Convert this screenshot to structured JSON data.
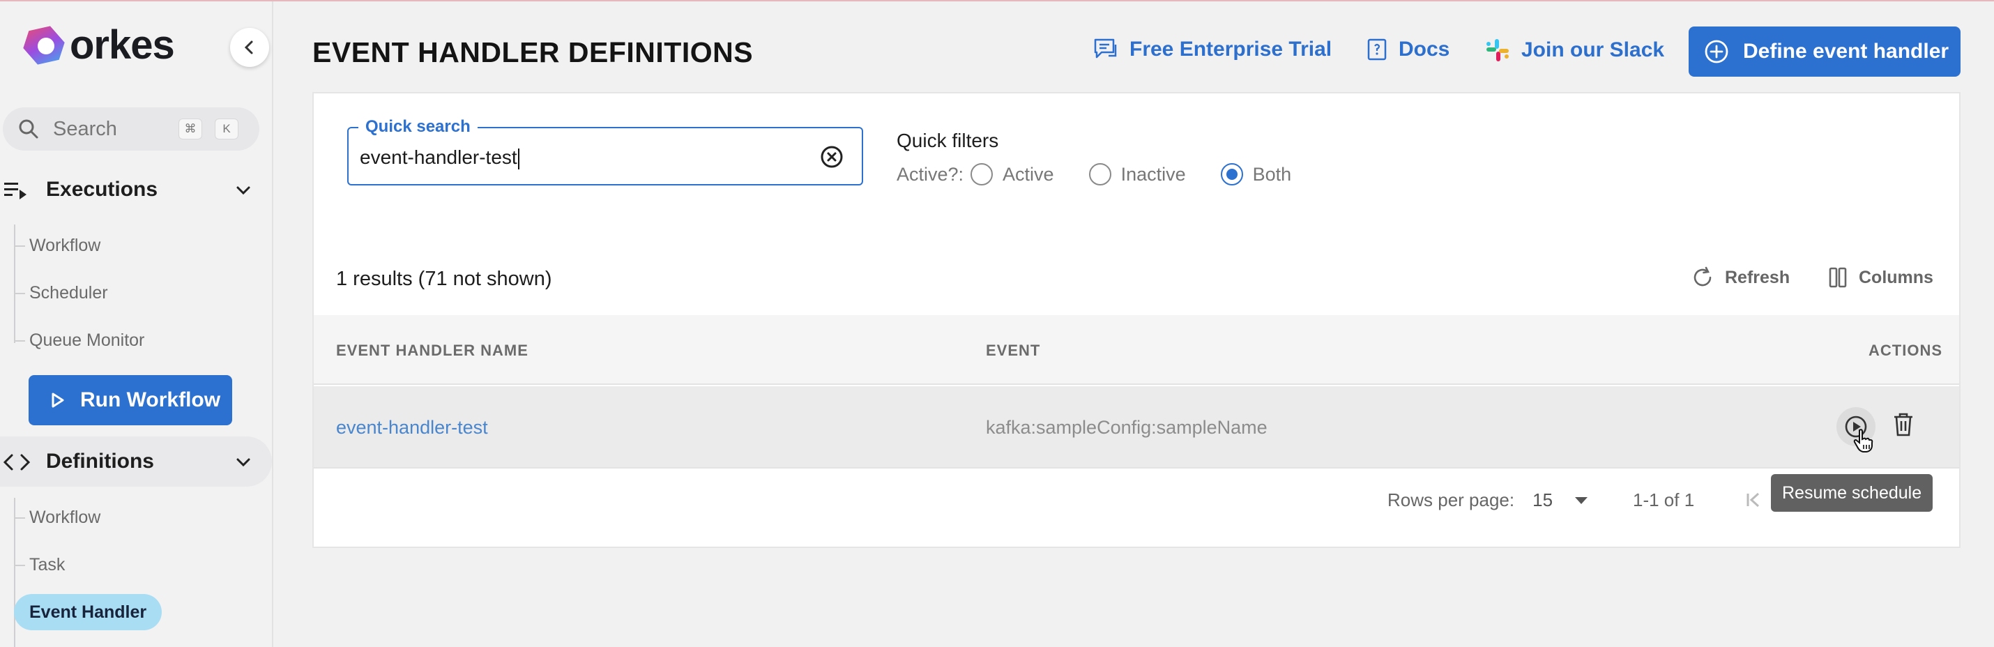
{
  "brand": {
    "name": "orkes"
  },
  "sidebar": {
    "search_placeholder": "Search",
    "shortcut_keys": [
      "⌘",
      "K"
    ],
    "sections": [
      {
        "label": "Executions",
        "items": [
          "Workflow",
          "Scheduler",
          "Queue Monitor"
        ]
      },
      {
        "label": "Definitions",
        "items": [
          "Workflow",
          "Task",
          "Event Handler"
        ]
      }
    ],
    "run_workflow_label": "Run Workflow",
    "selected_item": "Event Handler"
  },
  "header": {
    "title": "EVENT HANDLER DEFINITIONS",
    "links": [
      "Free Enterprise Trial",
      "Docs",
      "Join our Slack"
    ],
    "define_button": "Define event handler"
  },
  "search": {
    "legend": "Quick search",
    "value": "event-handler-test"
  },
  "filters": {
    "title": "Quick filters",
    "active_label": "Active?:",
    "options": [
      "Active",
      "Inactive",
      "Both"
    ],
    "selected": "Both"
  },
  "results": {
    "summary": "1 results (71 not shown)",
    "refresh_label": "Refresh",
    "columns_label": "Columns"
  },
  "table": {
    "columns": [
      "EVENT HANDLER NAME",
      "EVENT",
      "ACTIONS"
    ],
    "rows": [
      {
        "name": "event-handler-test",
        "event": "kafka:sampleConfig:sampleName"
      }
    ]
  },
  "tooltip": "Resume schedule",
  "pagination": {
    "rows_per_page_label": "Rows per page:",
    "rows_per_page": "15",
    "range": "1-1 of 1"
  },
  "colors": {
    "primary": "#2d71d0",
    "selected_nav": "#a9ddf4",
    "link": "#4a86cc"
  }
}
